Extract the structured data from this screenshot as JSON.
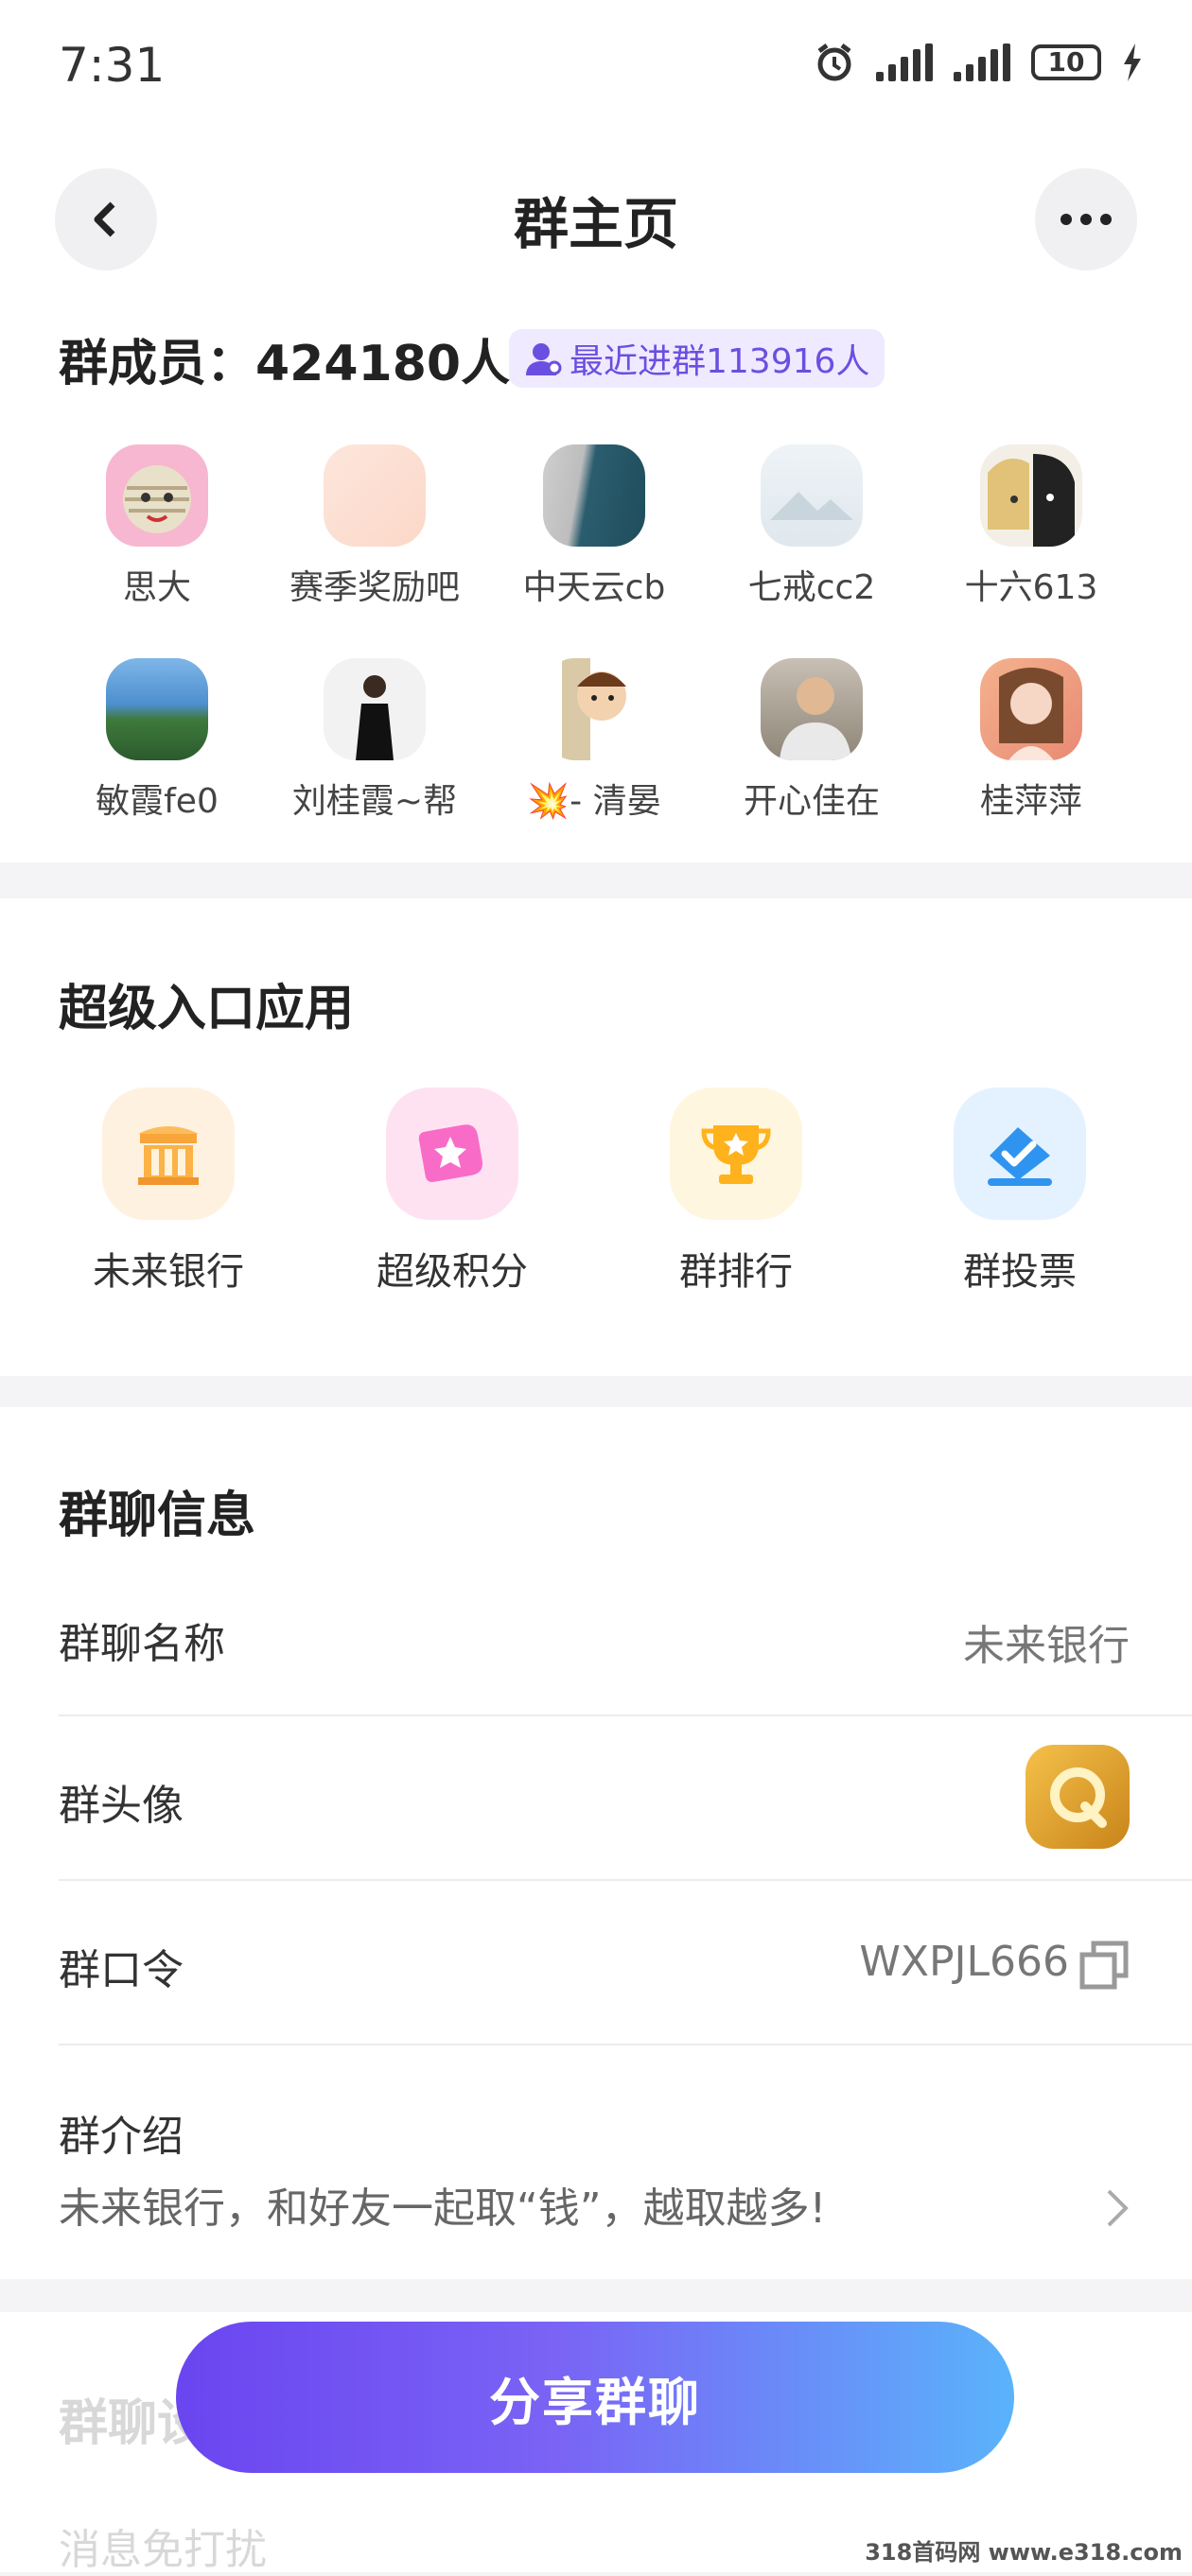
{
  "status_bar": {
    "time": "7:31",
    "battery": "10"
  },
  "header": {
    "title": "群主页"
  },
  "members": {
    "label": "群成员：424180人",
    "recent": "最近进群113916人",
    "list": [
      {
        "name": "思大"
      },
      {
        "name": "赛季奖励吧"
      },
      {
        "name": "中天云cb"
      },
      {
        "name": "七戒cc2"
      },
      {
        "name": "十六613"
      },
      {
        "name": "敏霞fe0"
      },
      {
        "name": "刘桂霞~帮"
      },
      {
        "name": "💥- 清晏"
      },
      {
        "name": "开心佳在"
      },
      {
        "name": "桂萍萍"
      }
    ]
  },
  "super_apps": {
    "title": "超级入口应用",
    "items": [
      {
        "label": "未来银行",
        "icon": "bank-icon"
      },
      {
        "label": "超级积分",
        "icon": "points-icon"
      },
      {
        "label": "群排行",
        "icon": "trophy-icon"
      },
      {
        "label": "群投票",
        "icon": "vote-icon"
      }
    ]
  },
  "group_info": {
    "title": "群聊信息",
    "name_label": "群聊名称",
    "name_value": "未来银行",
    "avatar_label": "群头像",
    "code_label": "群口令",
    "code_value": "WXPJL666",
    "intro_label": "群介绍",
    "intro_value": "未来银行，和好友一起取“钱”，越取越多!"
  },
  "next_section": {
    "title": "群聊设置",
    "row": "消息免打扰"
  },
  "share_button": "分享群聊",
  "watermark": "318首码网 www.e318.com"
}
